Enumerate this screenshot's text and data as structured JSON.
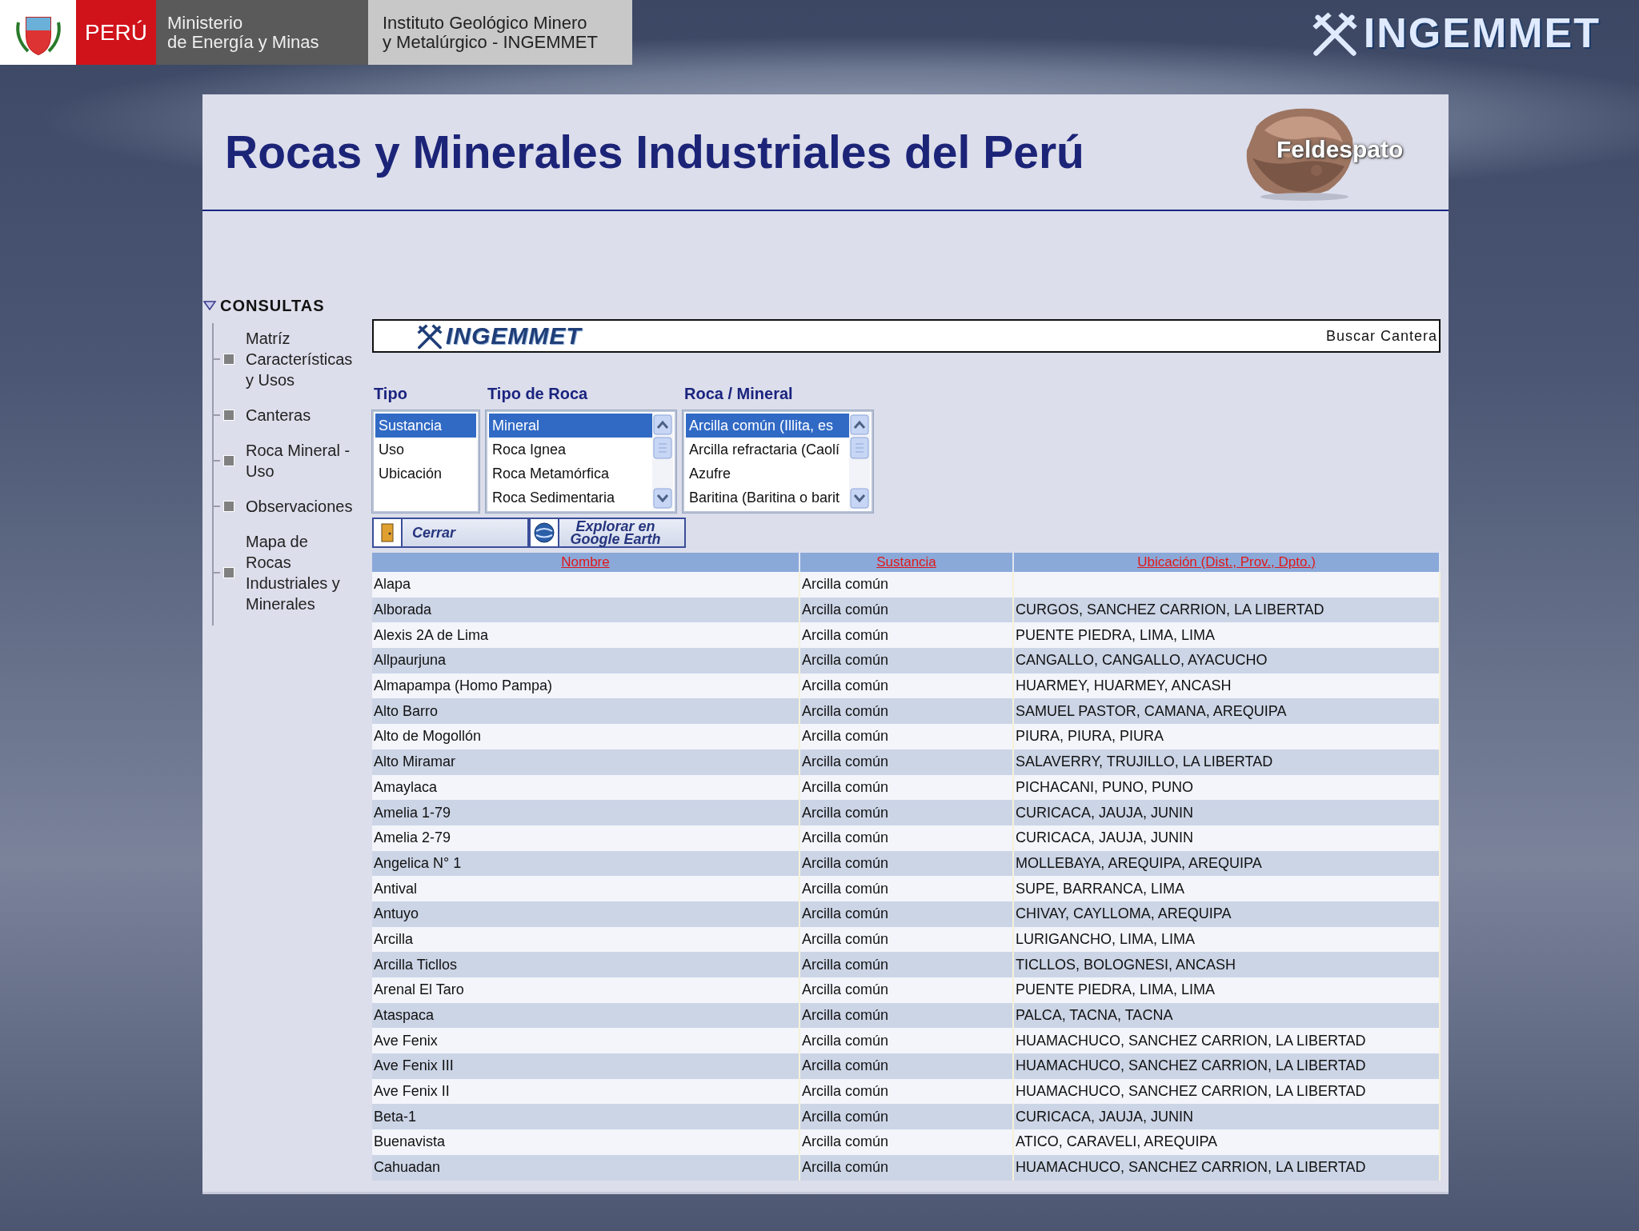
{
  "header": {
    "country": "PERÚ",
    "ministry": [
      "Ministerio",
      "de Energía y Minas"
    ],
    "institute": [
      "Instituto Geológico Minero",
      "y Metalúrgico - INGEMMET"
    ],
    "brand": "INGEMMET"
  },
  "page": {
    "title": "Rocas y Minerales Industriales del Perú",
    "feature": "Feldespato"
  },
  "sidebar": {
    "title": "CONSULTAS",
    "expanded": true,
    "items": [
      {
        "lines": [
          "Matríz",
          "Características",
          "y Usos"
        ]
      },
      {
        "lines": [
          "Canteras"
        ]
      },
      {
        "lines": [
          "Roca Mineral -",
          "Uso"
        ]
      },
      {
        "lines": [
          "Observaciones"
        ]
      },
      {
        "lines": [
          "Mapa de",
          "Rocas",
          "Industriales y",
          "Minerales"
        ]
      }
    ]
  },
  "search": {
    "brand": "INGEMMET",
    "link": "Buscar Cantera"
  },
  "filters": [
    {
      "label": "Tipo",
      "scrollable": false,
      "items": [
        {
          "text": "Sustancia",
          "selected": true
        },
        {
          "text": "Uso",
          "selected": false
        },
        {
          "text": "Ubicación",
          "selected": false
        }
      ]
    },
    {
      "label": "Tipo de Roca",
      "scrollable": true,
      "items": [
        {
          "text": "Mineral",
          "selected": true
        },
        {
          "text": "Roca Ignea",
          "selected": false
        },
        {
          "text": "Roca Metamórfica",
          "selected": false
        },
        {
          "text": "Roca Sedimentaria",
          "selected": false
        }
      ]
    },
    {
      "label": "Roca / Mineral",
      "scrollable": true,
      "items": [
        {
          "text": "Arcilla común (Illita, es",
          "selected": true
        },
        {
          "text": "Arcilla refractaria (Caolí",
          "selected": false
        },
        {
          "text": "Azufre",
          "selected": false
        },
        {
          "text": "Baritina (Baritina o barit",
          "selected": false
        }
      ]
    }
  ],
  "buttons": [
    {
      "kind": "close",
      "label": "Cerrar"
    },
    {
      "kind": "globe",
      "label": "Explorar en Google Earth"
    }
  ],
  "table": {
    "columns": [
      "Nombre",
      "Sustancia",
      "Ubicación (Dist., Prov., Dpto.)"
    ],
    "rows": [
      {
        "nombre": "Alapa",
        "sustancia": "Arcilla común"
      },
      {
        "nombre": "Alborada",
        "sustancia": "Arcilla común",
        "ubicacion": "CURGOS, SANCHEZ CARRION, LA LIBERTAD"
      },
      {
        "nombre": "Alexis 2A de Lima",
        "sustancia": "Arcilla común",
        "ubicacion": "PUENTE PIEDRA, LIMA, LIMA"
      },
      {
        "nombre": "Allpaurjuna",
        "sustancia": "Arcilla común",
        "ubicacion": "CANGALLO, CANGALLO, AYACUCHO"
      },
      {
        "nombre": "Almapampa (Homo Pampa)",
        "sustancia": "Arcilla común",
        "ubicacion": "HUARMEY, HUARMEY, ANCASH"
      },
      {
        "nombre": "Alto Barro",
        "sustancia": "Arcilla común",
        "ubicacion": "SAMUEL PASTOR, CAMANA, AREQUIPA"
      },
      {
        "nombre": "Alto de Mogollón",
        "sustancia": "Arcilla común",
        "ubicacion": "PIURA, PIURA, PIURA"
      },
      {
        "nombre": "Alto Miramar",
        "sustancia": "Arcilla común",
        "ubicacion": "SALAVERRY, TRUJILLO, LA LIBERTAD"
      },
      {
        "nombre": "Amaylaca",
        "sustancia": "Arcilla común",
        "ubicacion": "PICHACANI, PUNO, PUNO"
      },
      {
        "nombre": "Amelia 1-79",
        "sustancia": "Arcilla común",
        "ubicacion": "CURICACA, JAUJA, JUNIN"
      },
      {
        "nombre": "Amelia 2-79",
        "sustancia": "Arcilla común",
        "ubicacion": "CURICACA, JAUJA, JUNIN"
      },
      {
        "nombre": "Angelica N° 1",
        "sustancia": "Arcilla común",
        "ubicacion": "MOLLEBAYA, AREQUIPA, AREQUIPA"
      },
      {
        "nombre": "Antival",
        "sustancia": "Arcilla común",
        "ubicacion": "SUPE, BARRANCA, LIMA"
      },
      {
        "nombre": "Antuyo",
        "sustancia": "Arcilla común",
        "ubicacion": "CHIVAY, CAYLLOMA, AREQUIPA"
      },
      {
        "nombre": "Arcilla",
        "sustancia": "Arcilla común",
        "ubicacion": "LURIGANCHO, LIMA, LIMA"
      },
      {
        "nombre": "Arcilla Ticllos",
        "sustancia": "Arcilla común",
        "ubicacion": "TICLLOS, BOLOGNESI, ANCASH"
      },
      {
        "nombre": "Arenal El Taro",
        "sustancia": "Arcilla común",
        "ubicacion": "PUENTE PIEDRA, LIMA, LIMA"
      },
      {
        "nombre": "Ataspaca",
        "sustancia": "Arcilla común",
        "ubicacion": "PALCA, TACNA, TACNA"
      },
      {
        "nombre": "Ave Fenix",
        "sustancia": "Arcilla común",
        "ubicacion": "HUAMACHUCO, SANCHEZ CARRION, LA LIBERTAD"
      },
      {
        "nombre": "Ave Fenix III",
        "sustancia": "Arcilla común",
        "ubicacion": "HUAMACHUCO, SANCHEZ CARRION, LA LIBERTAD"
      },
      {
        "nombre": "Ave Fenix II",
        "sustancia": "Arcilla común",
        "ubicacion": "HUAMACHUCO, SANCHEZ CARRION, LA LIBERTAD"
      },
      {
        "nombre": "Beta-1",
        "sustancia": "Arcilla común",
        "ubicacion": "CURICACA, JAUJA, JUNIN"
      },
      {
        "nombre": "Buenavista",
        "sustancia": "Arcilla común",
        "ubicacion": "ATICO, CARAVELI, AREQUIPA"
      },
      {
        "nombre": "Cahuadan",
        "sustancia": "Arcilla común",
        "ubicacion": "HUAMACHUCO, SANCHEZ CARRION, LA LIBERTAD"
      }
    ]
  }
}
